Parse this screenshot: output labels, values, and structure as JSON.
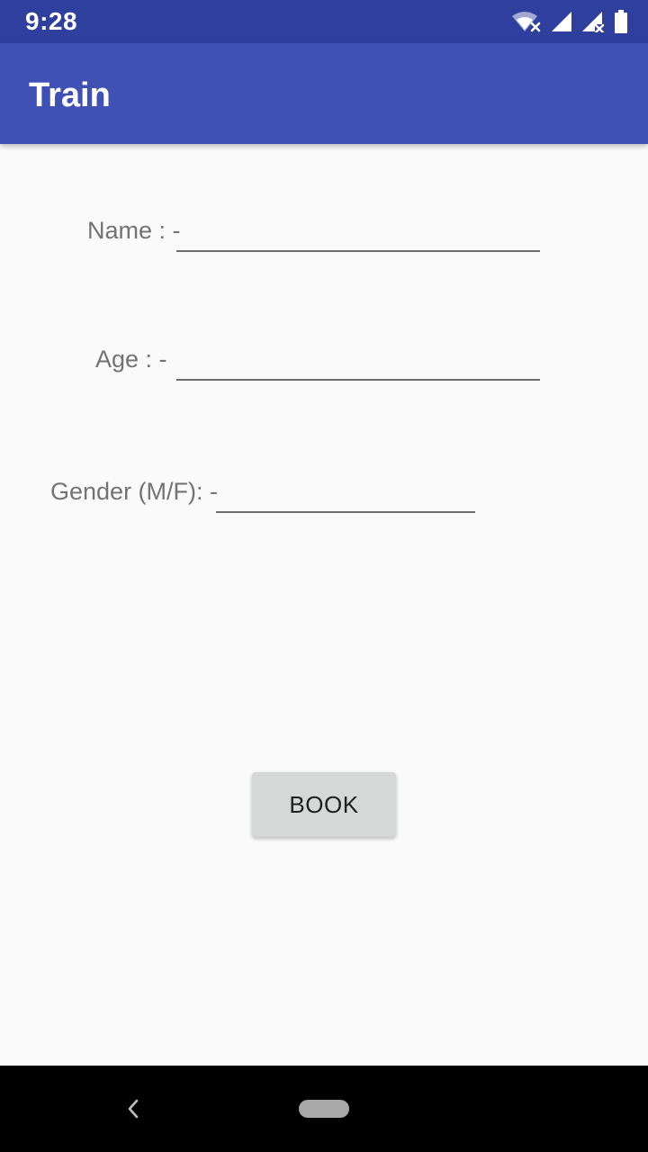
{
  "status_bar": {
    "time": "9:28",
    "icons": [
      "wifi-off-icon",
      "cell-signal-icon",
      "cell-signal-no-data-icon",
      "battery-icon"
    ]
  },
  "app_bar": {
    "title": "Train",
    "color": "#3f51b5"
  },
  "form": {
    "name": {
      "label": "Name : -",
      "value": ""
    },
    "age": {
      "label": "Age : -",
      "value": ""
    },
    "gender": {
      "label": "Gender (M/F): -",
      "value": ""
    }
  },
  "book_button": {
    "label": "BOOK"
  },
  "nav_bar": {
    "icons": [
      "back-icon",
      "home-pill-icon"
    ]
  },
  "colors": {
    "status_bar": "#2f3f9e",
    "primary": "#3f51b5",
    "background": "#fafafa",
    "button": "#d6d7d7"
  }
}
